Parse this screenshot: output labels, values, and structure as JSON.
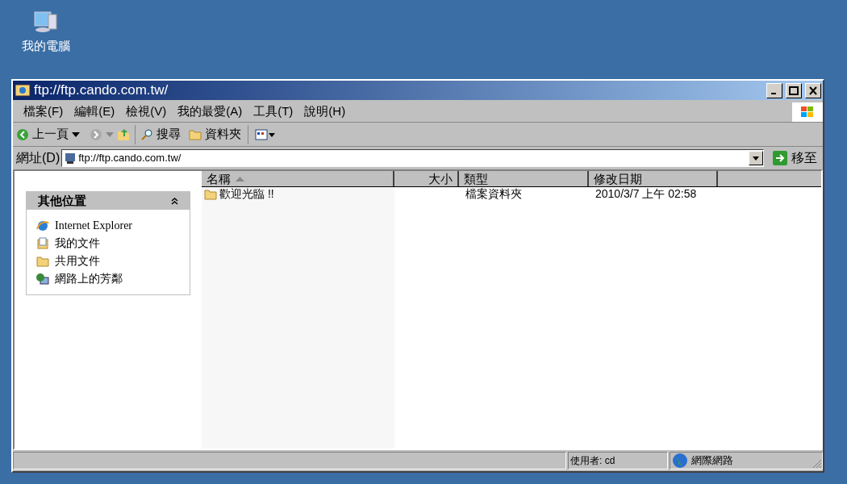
{
  "desktop_icon": {
    "label": "我的電腦"
  },
  "window": {
    "title": "ftp://ftp.cando.com.tw/"
  },
  "menu": [
    "檔案(F)",
    "編輯(E)",
    "檢視(V)",
    "我的最愛(A)",
    "工具(T)",
    "說明(H)"
  ],
  "toolbar": {
    "back": "上一頁",
    "search": "搜尋",
    "folders": "資料夾"
  },
  "address": {
    "label": "網址(D)",
    "value": "ftp://ftp.cando.com.tw/",
    "go": "移至"
  },
  "side_panel": {
    "title": "其他位置",
    "expanded": true,
    "items": [
      {
        "kind": "ie",
        "label": "Internet Explorer"
      },
      {
        "kind": "docs",
        "label": "我的文件"
      },
      {
        "kind": "folder",
        "label": "共用文件"
      },
      {
        "kind": "network",
        "label": "網路上的芳鄰"
      }
    ]
  },
  "table": {
    "columns": [
      {
        "label": "名稱",
        "sorted": true
      },
      {
        "label": "大小",
        "sorted": false
      },
      {
        "label": "類型",
        "sorted": false
      },
      {
        "label": "修改日期",
        "sorted": false
      }
    ],
    "rows": [
      {
        "cells": [
          "歡迎光臨 !!",
          "",
          "檔案資料夾",
          "2010/3/7 上午 02:58"
        ]
      }
    ]
  },
  "status_bar": {
    "user": "使用者: cd",
    "zone": "網際網路"
  }
}
